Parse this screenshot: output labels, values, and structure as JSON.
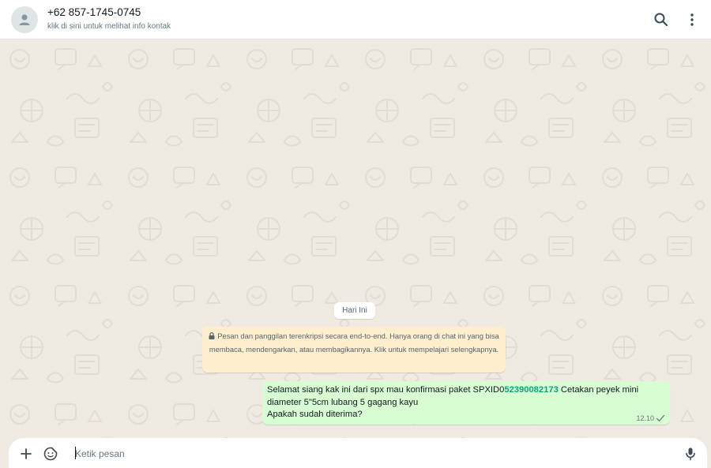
{
  "header": {
    "contact_name": "+62 857-1745-0745",
    "contact_subtitle": "klik di sini untuk melihat info kontak",
    "search_icon": "search-icon",
    "menu_icon": "kebab-menu-icon"
  },
  "chat": {
    "day_label": "Hari Ini",
    "encryption_notice": "Pesan dan panggilan terenkripsi secara end-to-end. Hanya orang di chat ini yang bisa membaca, mendengarkan, atau membagikannya. Klik untuk mempelajari selengkapnya.",
    "message": {
      "text_before_link": "Selamat siang kak ini dari spx mau konfirmasi paket SPXID0",
      "link_text": "52390082173",
      "text_after_link": " Cetakan peyek mini",
      "line2": "diameter 5\"5cm lubang 5 gagang kayu",
      "line3": "Apakah sudah diterima?",
      "time": "12.10",
      "status_icon": "single-check-icon"
    }
  },
  "composer": {
    "placeholder": "Ketik pesan",
    "attach_icon": "plus-icon",
    "sticker_icon": "sticker-icon",
    "mic_icon": "microphone-icon"
  },
  "colors": {
    "chat_background": "#efeae2",
    "outgoing_bubble": "#d9fdd3",
    "notice_background": "#ffeecd",
    "link_color": "#06a77d"
  }
}
